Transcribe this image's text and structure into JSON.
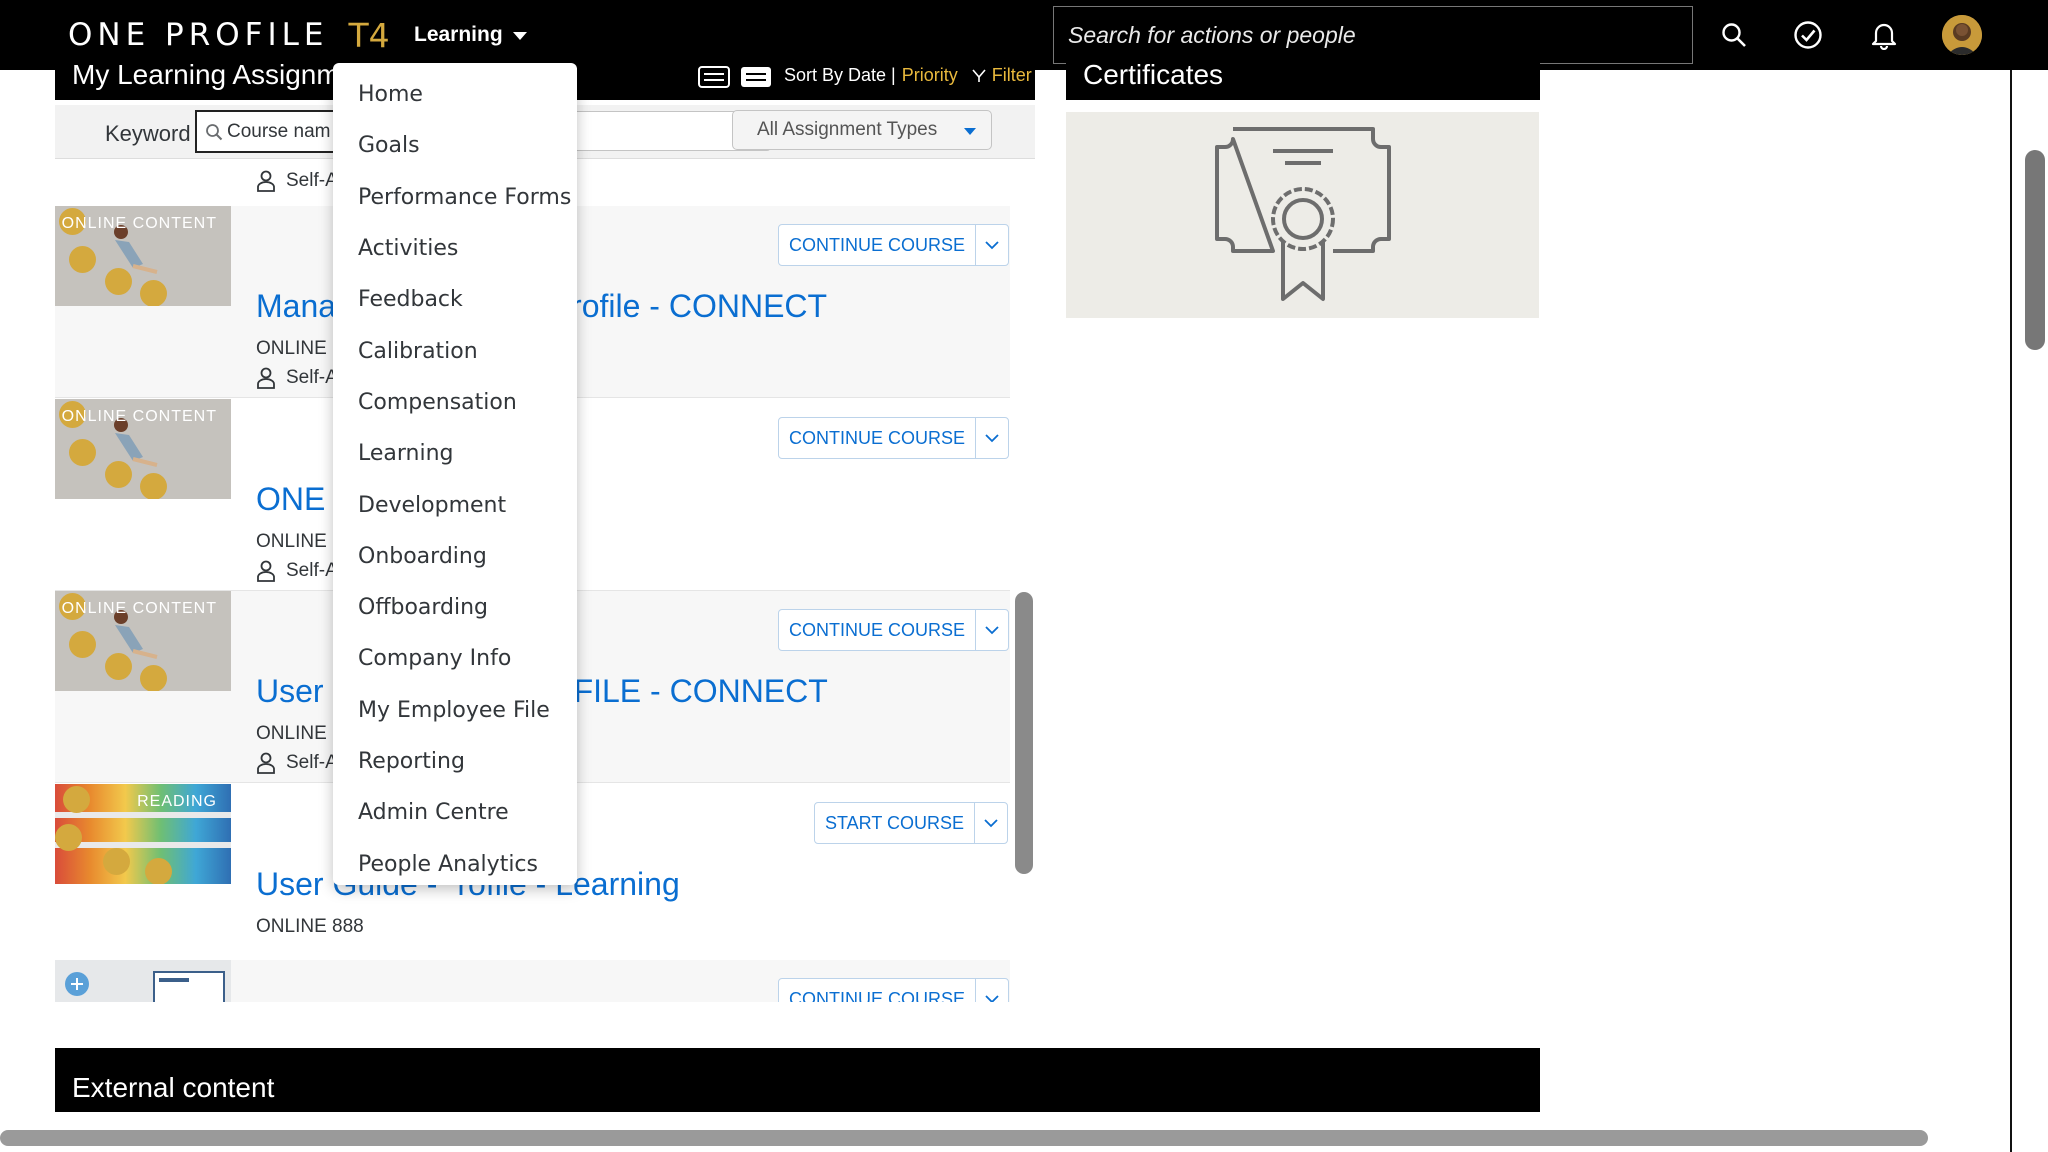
{
  "brand": {
    "name": "ONE PROFILE",
    "suffix": "T4"
  },
  "topbar": {
    "module_label": "Learning",
    "search_placeholder": "Search for actions or people",
    "icons": [
      "search-icon",
      "approval-check-icon",
      "notification-bell-icon",
      "user-avatar"
    ]
  },
  "assignments": {
    "title": "My Learning Assignm",
    "sort_label": "Sort By Date |",
    "priority_label": "Priority",
    "filter_label": "Filter",
    "keyword_label": "Keyword",
    "keyword_placeholder": "Course nam",
    "assignment_type": "All Assignment Types"
  },
  "course_list": {
    "top_self_label": "Self-A",
    "items": [
      {
        "tag": "ONLINE CONTENT",
        "title_left": "Mana",
        "title_right": "rofile - CONNECT",
        "code": "ONLINE 1",
        "self": "Self-A",
        "button": "CONTINUE COURSE"
      },
      {
        "tag": "ONLINE CONTENT",
        "title_left": "ONE",
        "title_right": "",
        "code": "ONLINE 1",
        "self": "Self-A",
        "button": "CONTINUE COURSE"
      },
      {
        "tag": "ONLINE CONTENT",
        "title_left": "User",
        "title_right": "FILE - CONNECT",
        "code": "ONLINE 1",
        "self": "Self-A",
        "button": "CONTINUE COURSE"
      },
      {
        "tag": "READING",
        "title_left": "User Guide -",
        "title_right": "rofile - Learning",
        "code": "ONLINE 888",
        "self": "",
        "button": "START COURSE"
      },
      {
        "tag": "",
        "title_left": "",
        "title_right": "",
        "code": "",
        "self": "",
        "button": "CONTINUE COURSE"
      }
    ]
  },
  "certificates": {
    "title": "Certificates"
  },
  "external": {
    "title": "External content"
  },
  "menu": {
    "items": [
      "Home",
      "Goals",
      "Performance Forms",
      "Activities",
      "Feedback",
      "Calibration",
      "Compensation",
      "Learning",
      "Development",
      "Onboarding",
      "Offboarding",
      "Company Info",
      "My Employee File",
      "Reporting",
      "Admin Centre",
      "People Analytics"
    ]
  },
  "colors": {
    "accent": "#0a6ed1",
    "brand_gold": "#d4a93e",
    "header_bg": "#000000"
  }
}
